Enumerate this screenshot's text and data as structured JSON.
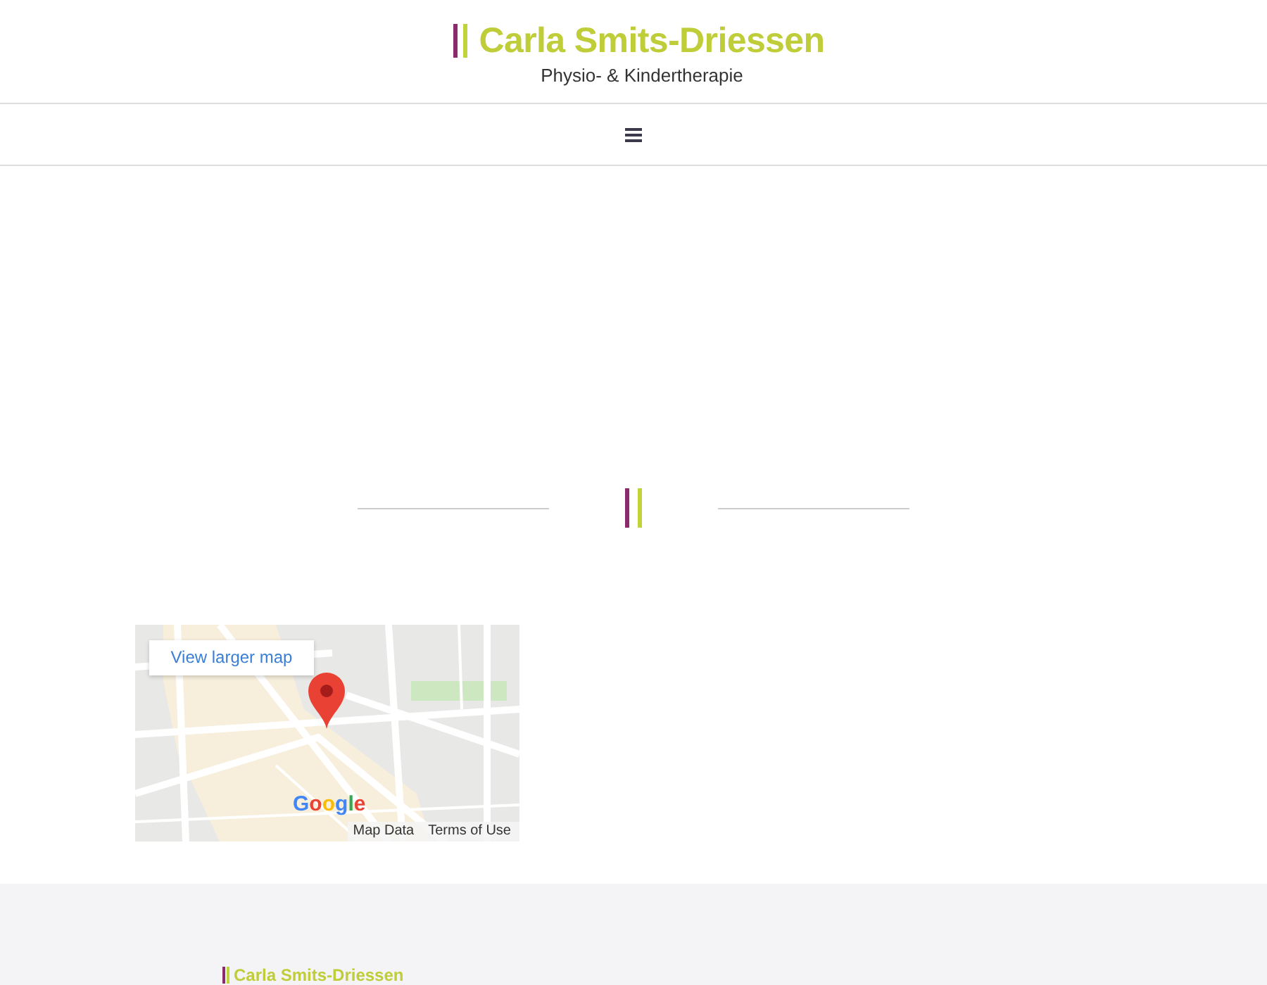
{
  "header": {
    "logo_title": "Carla Smits-Driessen",
    "logo_subtitle": "Physio- & Kindertherapie"
  },
  "map": {
    "link": "View larger map",
    "logo": "Google",
    "attribution": [
      "Map Data",
      "Terms of Use"
    ]
  },
  "footer": {
    "logo_title": "Carla Smits-Driessen"
  }
}
